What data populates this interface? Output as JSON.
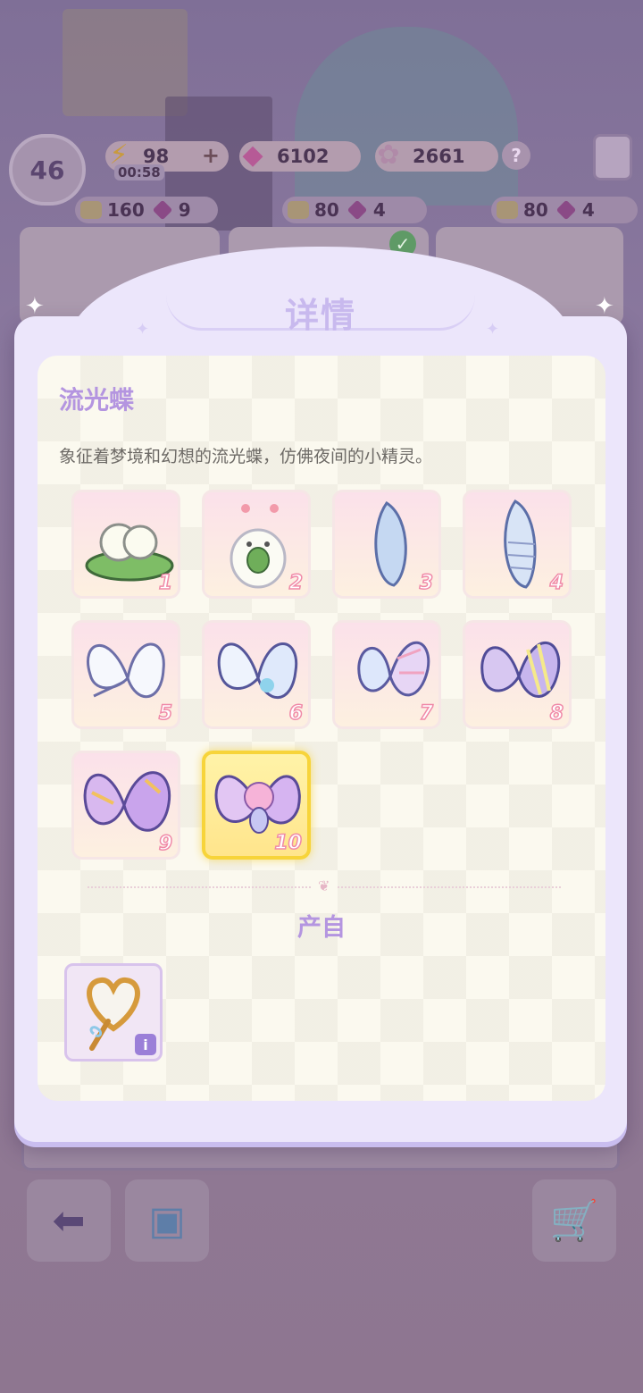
{
  "hud": {
    "level": "46",
    "energy": "98",
    "energy_plus": "+",
    "energy_timer": "00:58",
    "gems": "6102",
    "stars": "2661",
    "help": "?"
  },
  "shop": {
    "slots": [
      {
        "coin_price": "160",
        "gem_price": "9"
      },
      {
        "coin_price": "80",
        "gem_price": "4"
      },
      {
        "coin_price": "80",
        "gem_price": "4"
      }
    ]
  },
  "modal": {
    "title": "详情",
    "item_name": "流光蝶",
    "item_description": "象征着梦境和幻想的流光蝶，仿佛夜间的小精灵。",
    "stages": [
      {
        "number": "1",
        "icon": "cocoon-eggs-on-leaf-icon"
      },
      {
        "number": "2",
        "icon": "caterpillar-icon"
      },
      {
        "number": "3",
        "icon": "chrysalis-icon"
      },
      {
        "number": "4",
        "icon": "ridged-chrysalis-icon"
      },
      {
        "number": "5",
        "icon": "white-butterfly-icon"
      },
      {
        "number": "6",
        "icon": "blue-butterfly-icon"
      },
      {
        "number": "7",
        "icon": "pastel-butterfly-icon"
      },
      {
        "number": "8",
        "icon": "striped-butterfly-icon"
      },
      {
        "number": "9",
        "icon": "golden-butterfly-icon"
      },
      {
        "number": "10",
        "icon": "butterfly-fairy-icon"
      }
    ],
    "selected_stage": "10",
    "source_label": "产自",
    "source_items": [
      {
        "icon": "heart-butterfly-net-icon",
        "info": "i"
      }
    ]
  },
  "colors": {
    "accent_purple": "#b495e0",
    "selected_gold": "#f7d43a",
    "stage_number_pink": "#f08aa8"
  }
}
